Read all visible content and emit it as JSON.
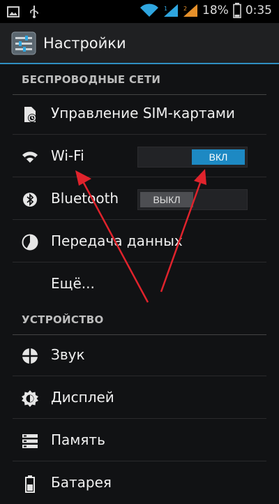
{
  "status_bar": {
    "battery_percent": "18%",
    "time": "0:35"
  },
  "action_bar": {
    "title": "Настройки"
  },
  "sections": {
    "wireless": "БЕСПРОВОДНЫЕ СЕТИ",
    "device": "УСТРОЙСТВО"
  },
  "items": {
    "sim": "Управление SIM-картами",
    "wifi": "Wi-Fi",
    "bluetooth": "Bluetooth",
    "data": "Передача данных",
    "more": "Ещё...",
    "sound": "Звук",
    "display": "Дисплей",
    "memory": "Память",
    "battery": "Батарея"
  },
  "toggles": {
    "wifi": {
      "label": "ВКЛ",
      "state": "on"
    },
    "bluetooth": {
      "label": "ВЫКЛ",
      "state": "off"
    }
  },
  "colors": {
    "accent": "#2f8fc2",
    "toggle_on": "#1d89c3",
    "arrow": "#e0232c"
  }
}
